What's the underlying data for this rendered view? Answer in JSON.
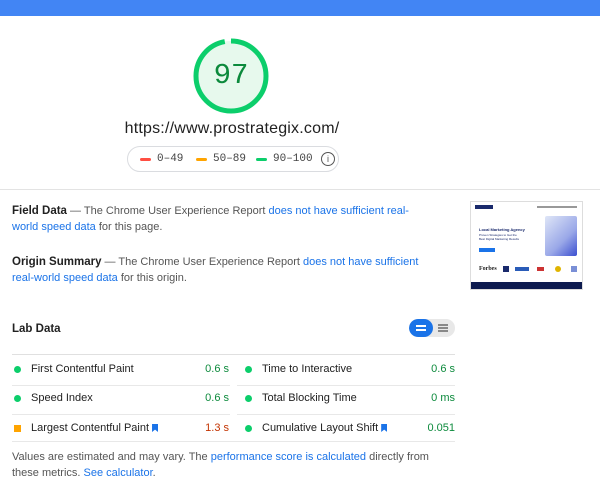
{
  "header": {
    "bar_color": "#4285f4"
  },
  "score": {
    "value": "97",
    "fraction": 0.97,
    "color": "#0cce6b"
  },
  "url": "https://www.prostrategix.com/",
  "legend": {
    "items": [
      {
        "label": "0–49",
        "color": "#ff4e42"
      },
      {
        "label": "50–89",
        "color": "#ffa400"
      },
      {
        "label": "90–100",
        "color": "#0cce6b"
      }
    ],
    "info_icon": "info-icon"
  },
  "field_data": {
    "title": "Field Data",
    "text_before": " — The Chrome User Experience Report ",
    "link": "does not have sufficient real-world speed data",
    "text_after": " for this page."
  },
  "origin_summary": {
    "title": "Origin Summary",
    "text_before": " — The Chrome User Experience Report ",
    "link": "does not have sufficient real-world speed data",
    "text_after": " for this origin."
  },
  "lab_data": {
    "title": "Lab Data",
    "metrics": [
      {
        "label": "First Contentful Paint",
        "value": "0.6 s",
        "status": "good"
      },
      {
        "label": "Time to Interactive",
        "value": "0.6 s",
        "status": "good"
      },
      {
        "label": "Speed Index",
        "value": "0.6 s",
        "status": "good"
      },
      {
        "label": "Total Blocking Time",
        "value": "0 ms",
        "status": "good"
      },
      {
        "label": "Largest Contentful Paint",
        "value": "1.3 s",
        "status": "average"
      },
      {
        "label": "Cumulative Layout Shift",
        "value": "0.051",
        "status": "good"
      }
    ]
  },
  "footnote": {
    "text1": "Values are estimated and may vary. The ",
    "link1": "performance score is calculated",
    "text2": " directly from these metrics. ",
    "link2": "See calculator",
    "text3": "."
  },
  "thumbnail": {
    "heading": "Local Marketing Agency",
    "sub": "Proven Strategies to Get the Best Digital Marketing Results",
    "logo": "Forbes"
  }
}
